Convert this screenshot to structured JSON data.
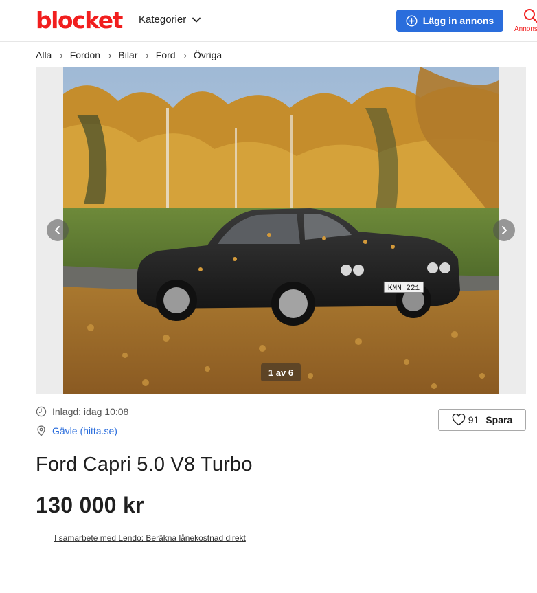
{
  "header": {
    "logo": "blocket",
    "categories_label": "Kategorier",
    "post_ad_label": "Lägg in annons",
    "search_label": "Annonser"
  },
  "breadcrumb": [
    "Alla",
    "Fordon",
    "Bilar",
    "Ford",
    "Övriga"
  ],
  "gallery": {
    "counter": "1 av 6",
    "plate_text": "KMN 221"
  },
  "listing": {
    "posted": "Inlagd: idag 10:08",
    "location": "Gävle (hitta.se)",
    "saves_count": "91",
    "save_label": "Spara",
    "title": "Ford Capri 5.0 V8 Turbo",
    "price": "130 000 kr",
    "loan_link": "I samarbete med Lendo: Beräkna lånekostnad direkt"
  },
  "colors": {
    "brand": "#f11e1e",
    "accent": "#2a6ddc"
  },
  "icons": {
    "categories": "chevron-down-icon",
    "post_ad": "plus-circle-icon",
    "search": "search-icon",
    "gallery_prev": "chevron-left-icon",
    "gallery_next": "chevron-right-icon",
    "posted": "clock-icon",
    "location": "location-pin-icon",
    "save": "heart-icon"
  }
}
